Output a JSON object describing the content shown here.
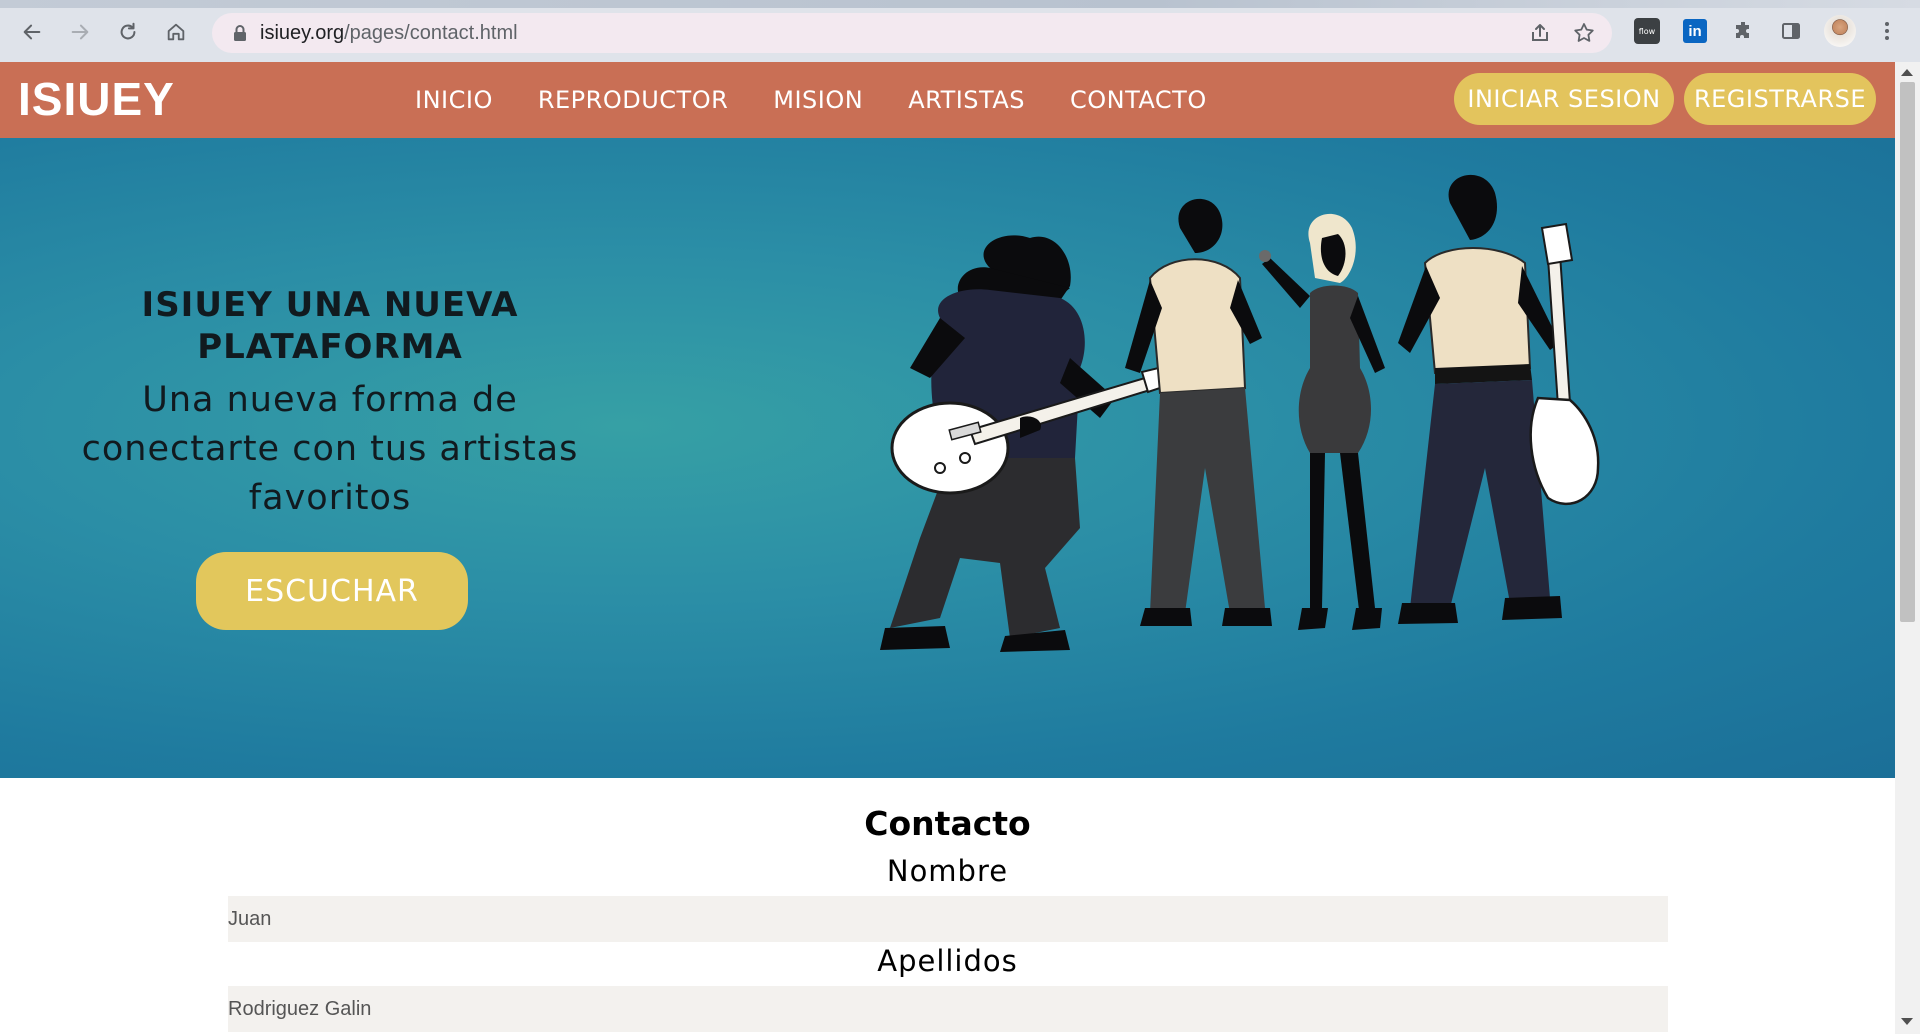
{
  "browser": {
    "url_domain": "isiuey.org",
    "url_path": "/pages/contact.html",
    "extension_flow_label": "flow",
    "extension_linkedin_label": "in"
  },
  "site": {
    "logo": "ISIUEY",
    "nav": [
      "INICIO",
      "REPRODUCTOR",
      "MISION",
      "ARTISTAS",
      "CONTACTO"
    ],
    "login_button": "INICIAR SESION",
    "register_button": "REGISTRARSE",
    "colors": {
      "header": "#c96f55",
      "accent": "#e3c45d",
      "hero": "#2b8ea6"
    }
  },
  "hero": {
    "title_line1": "ISIUEY UNA NUEVA",
    "title_line2": "PLATAFORMA",
    "subtitle_line1": "Una nueva forma de",
    "subtitle_line2": "conectarte con tus artistas",
    "subtitle_line3": "favoritos",
    "cta_button": "ESCUCHAR",
    "image_subject": "band-silhouette-illustration"
  },
  "contact": {
    "title": "Contacto",
    "fields": [
      {
        "label": "Nombre",
        "value": "Juan"
      },
      {
        "label": "Apellidos",
        "value": "Rodriguez Galin"
      }
    ]
  }
}
